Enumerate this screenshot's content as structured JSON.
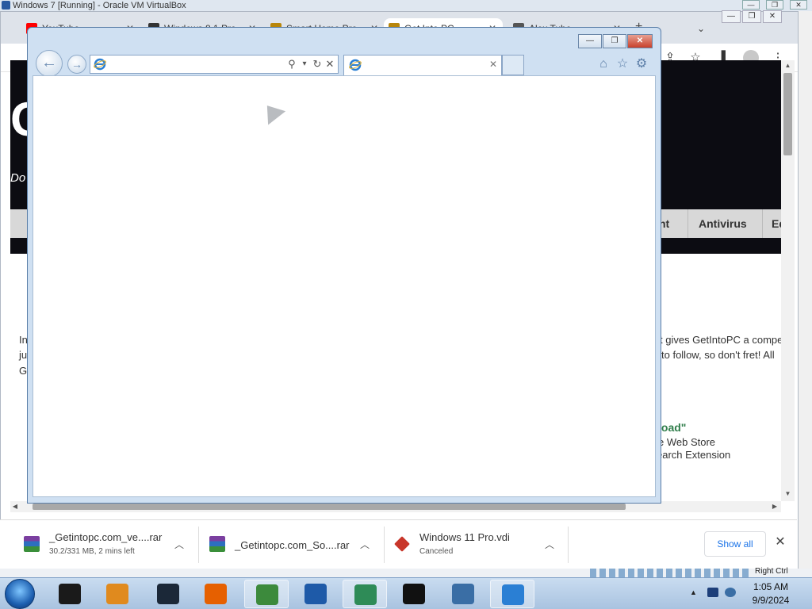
{
  "vbox": {
    "title": "Windows 7 [Running] - Oracle VM VirtualBox",
    "controls": {
      "minimize": "—",
      "restore": "❐",
      "close": "✕"
    },
    "status_hostkey": "Right Ctrl"
  },
  "chrome": {
    "tabs": [
      {
        "label": "YouTube",
        "favicon_color": "#ff0000"
      },
      {
        "label": "Windows 8.1 Pro",
        "favicon_color": "#333333"
      },
      {
        "label": "Smart Home Pro",
        "favicon_color": "#b8860b"
      },
      {
        "label": "Get Into PC",
        "favicon_color": "#b8860b"
      },
      {
        "label": "Alex Tube",
        "favicon_color": "#555555"
      }
    ],
    "new_tab_glyph": "+",
    "tab_menu_glyph": "⌄",
    "tab_close_glyph": "✕",
    "window_controls": {
      "minimize": "—",
      "restore": "❐",
      "close": "✕"
    },
    "toolbar_icons": [
      "share-icon",
      "star-icon",
      "side-panel-icon",
      "profile-icon",
      "kebab-menu-icon"
    ],
    "toolbar_glyphs": {
      "share": "⇪",
      "star": "☆",
      "side_panel": "▌",
      "menu": "⋮"
    }
  },
  "website": {
    "header_letter": "G",
    "tagline": "Do",
    "nav_items": [
      "nt",
      "Antivirus",
      "Ed"
    ],
    "body_left_lines": [
      "In",
      "ju",
      "G"
    ],
    "body_right_lines": [
      "t gives GetIntoPC a compe",
      "to follow, so don't fret! All"
    ],
    "download_heading": "load\"",
    "download_lines": [
      "e Web Store",
      "earch Extension"
    ],
    "colors": {
      "header_bg": "#0c0c12",
      "nav_bg": "#d8d8d8",
      "download_green": "#2f7d4a"
    }
  },
  "downloads": [
    {
      "name": "_Getintopc.com_ve....rar",
      "status": "30.2/331 MB, 2 mins left",
      "icon": "winrar-icon"
    },
    {
      "name": "_Getintopc.com_So....rar",
      "status": "",
      "icon": "winrar-icon"
    },
    {
      "name": "Windows 11 Pro.vdi",
      "status": "Canceled",
      "icon": "virtualbox-disk-icon"
    }
  ],
  "download_bar": {
    "show_all": "Show all",
    "close_glyph": "✕",
    "chevron_glyph": "︿"
  },
  "ie": {
    "window_controls": {
      "minimize": "—",
      "restore": "❐",
      "close": "✕"
    },
    "address_value": "",
    "tab_title": "",
    "address_glyphs": {
      "search": "⚲",
      "dropdown": "▾",
      "refresh": "↻",
      "stop": "✕"
    },
    "nav_glyphs": {
      "back": "←",
      "forward": "→"
    },
    "tab_close_glyph": "✕",
    "command_glyphs": {
      "home": "⌂",
      "favorites": "☆",
      "tools": "⚙"
    },
    "accent": "#cfe0f2"
  },
  "taskbar": {
    "pinned": [
      {
        "name": "video-app",
        "color": "#1a1a1a",
        "active": false
      },
      {
        "name": "media-player",
        "color": "#e08a1e",
        "active": false
      },
      {
        "name": "steam",
        "color": "#1b2838",
        "active": false
      },
      {
        "name": "firefox",
        "color": "#e66000",
        "active": false
      },
      {
        "name": "chrome",
        "color": "#3c8a3c",
        "active": true
      },
      {
        "name": "virtualbox",
        "color": "#1e5aa8",
        "active": false
      },
      {
        "name": "internet-download-manager",
        "color": "#2e8b57",
        "active": true
      },
      {
        "name": "task-manager",
        "color": "#111111",
        "active": false
      },
      {
        "name": "windows-7-64bit",
        "color": "#3a6ea5",
        "active": false
      },
      {
        "name": "internet-explorer",
        "color": "#2a7fd4",
        "active": true
      }
    ],
    "tray_arrow": "▲",
    "time": "1:05 AM",
    "date": "9/9/2024"
  }
}
